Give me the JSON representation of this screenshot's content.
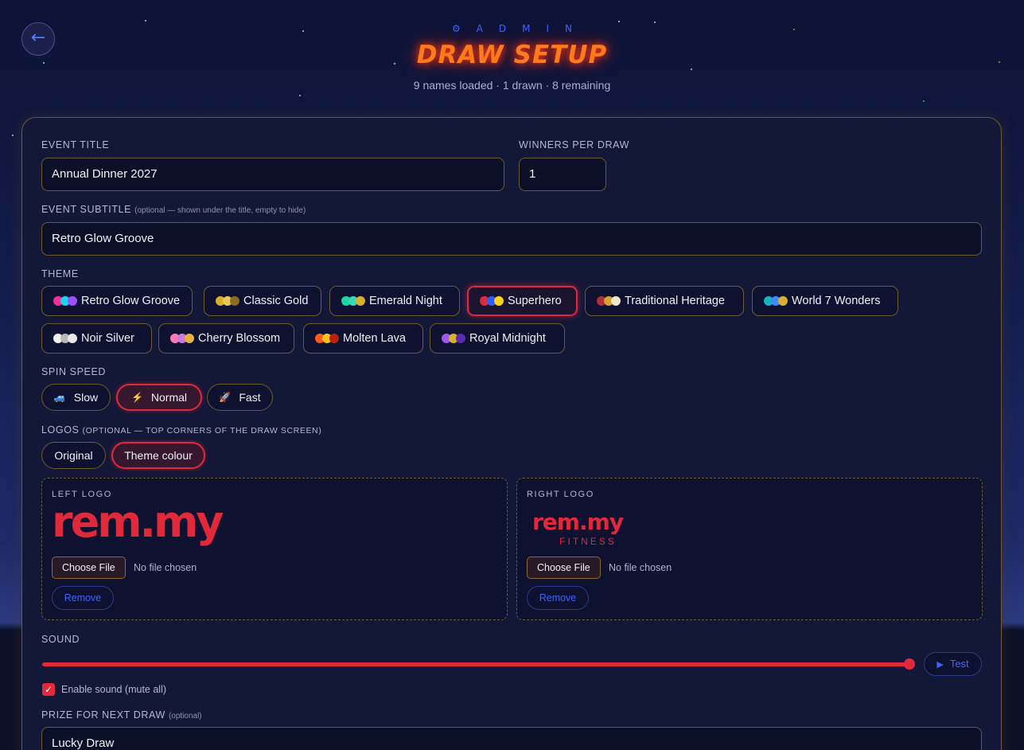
{
  "header": {
    "back_icon": "←",
    "kicker_icon": "⚙",
    "kicker": "ADMIN",
    "title": "DRAW SETUP",
    "stats": "9 names loaded · 1 drawn · 8 remaining"
  },
  "form": {
    "event_title": {
      "label": "EVENT TITLE",
      "value": "Annual Dinner 2027"
    },
    "winners_per_draw": {
      "label": "WINNERS PER DRAW",
      "value": "1"
    },
    "event_subtitle": {
      "label": "EVENT SUBTITLE",
      "hint": "(optional — shown under the title, empty to hide)",
      "value": "Retro Glow Groove"
    },
    "theme": {
      "label": "THEME",
      "selected": "Superhero",
      "options": [
        {
          "name": "Retro Glow Groove",
          "colors": [
            "#ff2d9a",
            "#1ad6e8",
            "#a04dff"
          ]
        },
        {
          "name": "Classic Gold",
          "colors": [
            "#d8b030",
            "#e8c858",
            "#8c6a22"
          ]
        },
        {
          "name": "Emerald Night",
          "colors": [
            "#1ad6a0",
            "#3ad6b8",
            "#d8b030"
          ]
        },
        {
          "name": "Superhero",
          "colors": [
            "#e0293a",
            "#2d5cff",
            "#ffd21a"
          ]
        },
        {
          "name": "Traditional Heritage",
          "colors": [
            "#b0303a",
            "#d8a030",
            "#f2e6cc"
          ]
        },
        {
          "name": "World 7 Wonders",
          "colors": [
            "#1ab0c0",
            "#3a8cff",
            "#d8b030"
          ]
        },
        {
          "name": "Noir Silver",
          "colors": [
            "#f0f0f0",
            "#b8b8b8",
            "#e8e8e8"
          ]
        },
        {
          "name": "Cherry Blossom",
          "colors": [
            "#ff78b8",
            "#c87ae0",
            "#e8b040"
          ]
        },
        {
          "name": "Molten Lava",
          "colors": [
            "#ff5a1a",
            "#ffc21a",
            "#b8200a"
          ]
        },
        {
          "name": "Royal Midnight",
          "colors": [
            "#9a5af0",
            "#d8b030",
            "#5a2ab0"
          ]
        }
      ]
    },
    "spin_speed": {
      "label": "SPIN SPEED",
      "selected": "Normal",
      "options": [
        {
          "name": "Slow",
          "icon": "car-icon",
          "glyph": "🚙",
          "color": "#3ac07a"
        },
        {
          "name": "Normal",
          "icon": "lightning-icon",
          "glyph": "⚡",
          "color": "#ff8a1a"
        },
        {
          "name": "Fast",
          "icon": "rocket-icon",
          "glyph": "🚀",
          "color": "#d84a8a"
        }
      ]
    },
    "logos": {
      "label": "LOGOS",
      "hint": "(OPTIONAL — TOP CORNERS OF THE DRAW SCREEN)",
      "selected": "Theme colour",
      "options": [
        "Original",
        "Theme colour"
      ],
      "left": {
        "label": "LEFT LOGO",
        "logo_text": "rem.my",
        "file_button": "Choose File",
        "file_status": "No file chosen",
        "remove": "Remove"
      },
      "right": {
        "label": "RIGHT LOGO",
        "logo_text": "rem.my",
        "logo_sub": "FITNESS",
        "file_button": "Choose File",
        "file_status": "No file chosen",
        "remove": "Remove"
      }
    },
    "sound": {
      "label": "SOUND",
      "volume": 1.0,
      "test_label": "Test",
      "test_icon": "▶",
      "enable_label": "Enable sound (mute all)",
      "enabled": true
    },
    "prize": {
      "label": "PRIZE FOR NEXT DRAW",
      "hint": "(optional)",
      "value": "Lucky Draw"
    }
  },
  "colors": {
    "accent": "#e0293a",
    "link": "#3d63ff",
    "border": "#6e5b2c",
    "title": "#ff7a1a"
  }
}
